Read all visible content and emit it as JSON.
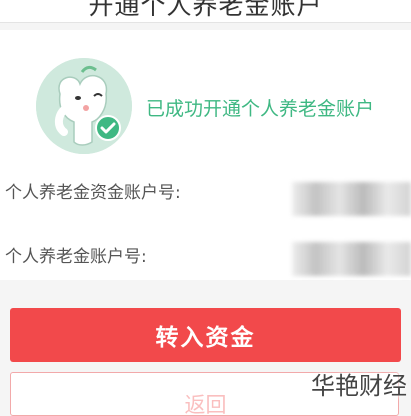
{
  "header": {
    "title": "开通个人养老金账户"
  },
  "status": {
    "message": "已成功开通个人养老金账户",
    "mascot_icon": "elephant-mascot-with-checkmark",
    "accent_color": "#3fb883"
  },
  "fields": [
    {
      "label": "个人养老金资金账户号:",
      "value_masked": true
    },
    {
      "label": "个人养老金账户号:",
      "value_masked": true
    }
  ],
  "actions": {
    "primary_label": "转入资金",
    "primary_color": "#f2494b",
    "secondary_label": "返回"
  },
  "watermark": "华艳财经"
}
